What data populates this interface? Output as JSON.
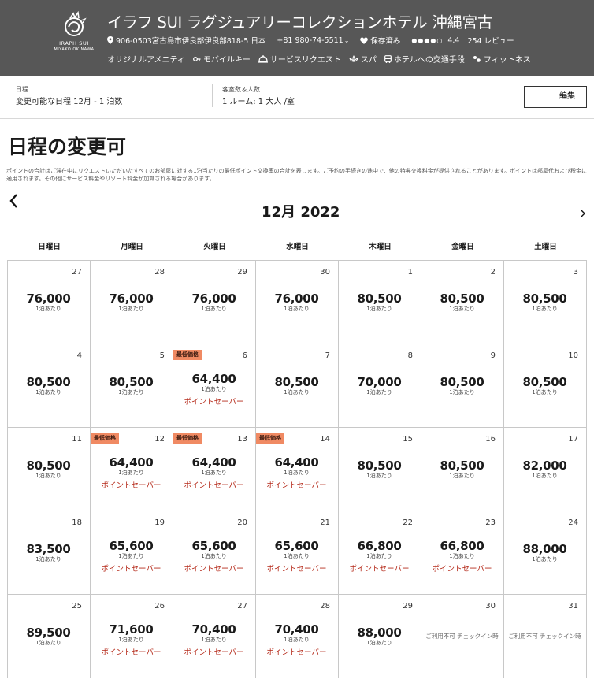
{
  "header": {
    "logo_line1": "IRAPH SUI",
    "logo_line2": "MIYAKO OKINAWA",
    "title": "イラフ SUI ラグジュアリーコレクションホテル 沖縄宮古",
    "address": "906-0503宮古島市伊良部伊良部818-5 日本",
    "phone": "+81 980-74-5511",
    "saved": "保存済み",
    "rating_dots": "●●●●○",
    "rating": "4.4",
    "reviews": "254 レビュー",
    "amenities": [
      {
        "label": "オリジナルアメニティ",
        "icon": "none"
      },
      {
        "label": "モバイルキー",
        "icon": "key-icon"
      },
      {
        "label": "サービスリクエスト",
        "icon": "service-bell-icon"
      },
      {
        "label": "スパ",
        "icon": "spa-icon"
      },
      {
        "label": "ホテルへの交通手段",
        "icon": "bus-icon"
      },
      {
        "label": "フィットネス",
        "icon": "fitness-icon"
      }
    ]
  },
  "search": {
    "dates_label": "日程",
    "dates_value": "変更可能な日程 12月 - 1 泊数",
    "guests_label": "客室数＆人数",
    "guests_value": "1 ルーム: 1 大人 /室",
    "edit_label": "編集"
  },
  "page_title": "日程の変更可",
  "disclaimer": "ポイントの合計はご滞在中にリクエストいただいたすべてのお部屋に対する1泊当たりの最低ポイント交換率の合計を表します。ご予約の手続きの途中で、他の特典交換料金が提供されることがあります。ポイントは部屋代および税金に適用されます。その他にサービス料金やリゾート料金が加算される場合があります。",
  "calendar": {
    "month_label": "12月 2022",
    "weekdays": [
      "日曜日",
      "月曜日",
      "火曜日",
      "水曜日",
      "木曜日",
      "金曜日",
      "土曜日"
    ],
    "per_night": "1泊あたり",
    "lowest_badge": "最低価格",
    "saver_label": "ポイントセーバー",
    "unavailable": "ご利用不可 チェックイン時",
    "days": [
      {
        "d": "27",
        "p": "76,000"
      },
      {
        "d": "28",
        "p": "76,000"
      },
      {
        "d": "29",
        "p": "76,000"
      },
      {
        "d": "30",
        "p": "76,000"
      },
      {
        "d": "1",
        "p": "80,500"
      },
      {
        "d": "2",
        "p": "80,500"
      },
      {
        "d": "3",
        "p": "80,500"
      },
      {
        "d": "4",
        "p": "80,500"
      },
      {
        "d": "5",
        "p": "80,500"
      },
      {
        "d": "6",
        "p": "64,400",
        "saver": true,
        "low": true
      },
      {
        "d": "7",
        "p": "80,500"
      },
      {
        "d": "8",
        "p": "70,000"
      },
      {
        "d": "9",
        "p": "80,500"
      },
      {
        "d": "10",
        "p": "80,500"
      },
      {
        "d": "11",
        "p": "80,500"
      },
      {
        "d": "12",
        "p": "64,400",
        "saver": true,
        "low": true
      },
      {
        "d": "13",
        "p": "64,400",
        "saver": true,
        "low": true
      },
      {
        "d": "14",
        "p": "64,400",
        "saver": true,
        "low": true
      },
      {
        "d": "15",
        "p": "80,500"
      },
      {
        "d": "16",
        "p": "80,500"
      },
      {
        "d": "17",
        "p": "82,000"
      },
      {
        "d": "18",
        "p": "83,500"
      },
      {
        "d": "19",
        "p": "65,600",
        "saver": true
      },
      {
        "d": "20",
        "p": "65,600",
        "saver": true
      },
      {
        "d": "21",
        "p": "65,600",
        "saver": true
      },
      {
        "d": "22",
        "p": "66,800",
        "saver": true
      },
      {
        "d": "23",
        "p": "66,800",
        "saver": true
      },
      {
        "d": "24",
        "p": "88,000"
      },
      {
        "d": "25",
        "p": "89,500"
      },
      {
        "d": "26",
        "p": "71,600",
        "saver": true
      },
      {
        "d": "27",
        "p": "70,400",
        "saver": true
      },
      {
        "d": "28",
        "p": "70,400",
        "saver": true
      },
      {
        "d": "29",
        "p": "88,000"
      },
      {
        "d": "30",
        "unavailable": true
      },
      {
        "d": "31",
        "unavailable": true
      }
    ]
  },
  "colors": {
    "header_bg": "#575757",
    "badge_bg": "#f08a63",
    "saver_text": "#b52a1a"
  }
}
